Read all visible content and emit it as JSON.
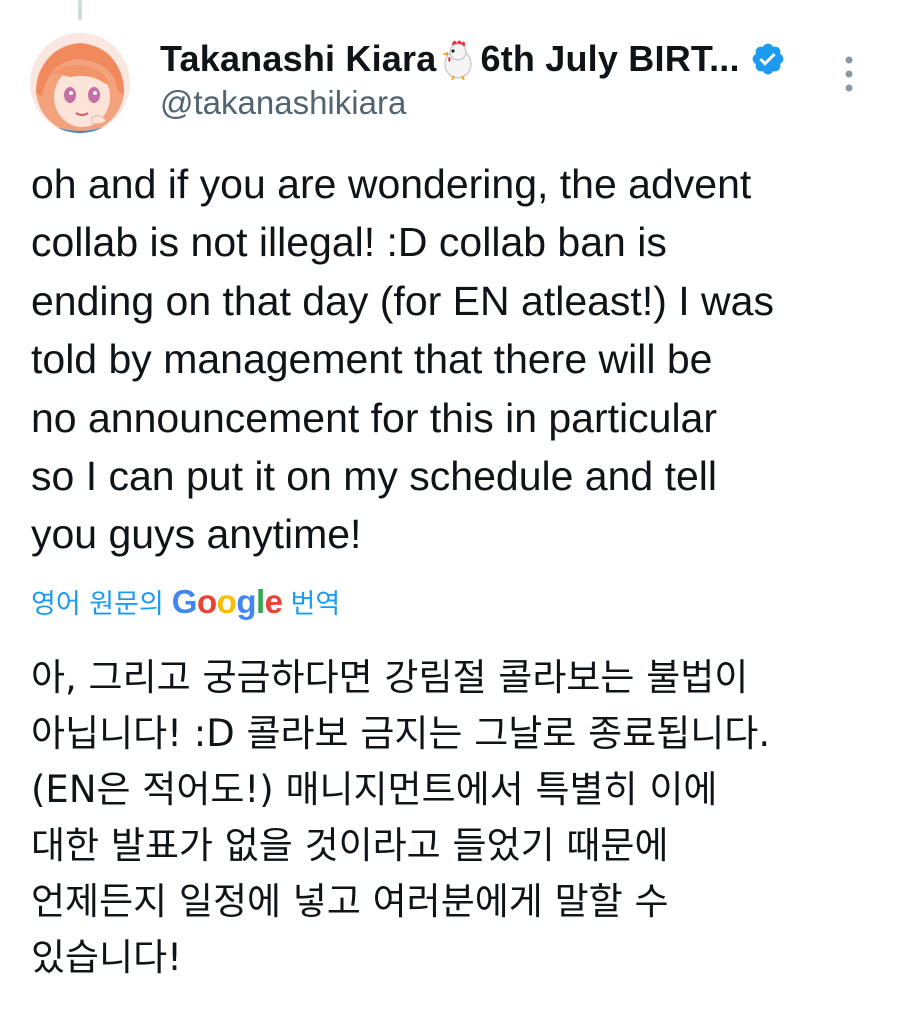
{
  "author": {
    "display_name": "Takanashi Kiara",
    "display_name_suffix": "6th July BIRT...",
    "handle": "@takanashikiara",
    "emoji_icon": "chicken-icon",
    "verified_icon": "verified-badge-icon"
  },
  "tweet": {
    "text": "oh and if you are wondering, the advent\ncollab is not illegal! :D collab ban is\nending on that day (for EN atleast!) I was\ntold by management that there will be\nno announcement for this in particular\nso I can put it on my schedule and tell\nyou guys anytime!"
  },
  "translation": {
    "prefix": "영어 원문의",
    "brand_letters": [
      "G",
      "o",
      "o",
      "g",
      "l",
      "e"
    ],
    "suffix": "번역",
    "text": "아, 그리고 궁금하다면 강림절 콜라보는 불법이\n아닙니다! :D 콜라보 금지는 그날로 종료됩니다.\n(EN은 적어도!) 매니지먼트에서 특별히 이에\n대한 발표가 없을 것이라고 들었기 때문에\n언제든지 일정에 넣고 여러분에게 말할 수\n있습니다!"
  },
  "icons": {
    "more": "more-options-icon",
    "avatar": "avatar"
  },
  "colors": {
    "link": "#1d9bf0",
    "secondary_text": "#536471",
    "primary_text": "#0f1419",
    "verified": "#1d9bf0"
  }
}
